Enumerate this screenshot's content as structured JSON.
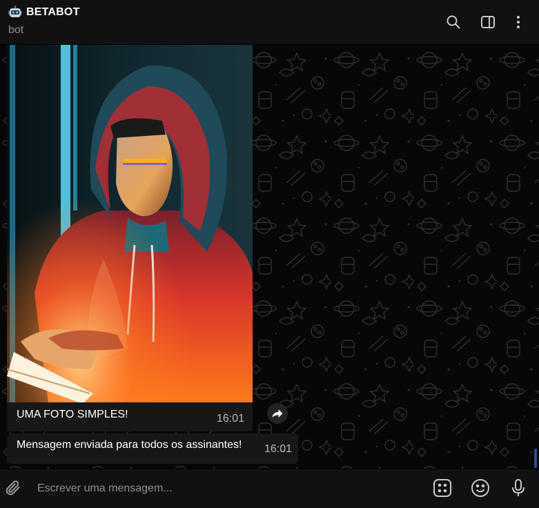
{
  "header": {
    "title": "BETABOT",
    "subtitle": "bot",
    "icons": [
      "bot-emoji-icon",
      "search-icon",
      "sidebar-toggle-icon",
      "more-vertical-icon"
    ]
  },
  "messages": {
    "photo": {
      "caption": "UMA FOTO SIMPLES!",
      "time": "16:01"
    },
    "text": {
      "body": "Mensagem enviada para todos os assinantes!",
      "time": "16:01"
    }
  },
  "composer": {
    "placeholder": "Escrever uma mensagem...",
    "icons": [
      "paperclip-icon",
      "bot-commands-icon",
      "emoji-icon",
      "microphone-icon"
    ]
  },
  "colors": {
    "header_bg": "#111111",
    "chat_bg": "#070707",
    "bubble_bg": "#171717",
    "muted_text": "#8a8f95",
    "scroll_accent": "#2d4e86"
  }
}
